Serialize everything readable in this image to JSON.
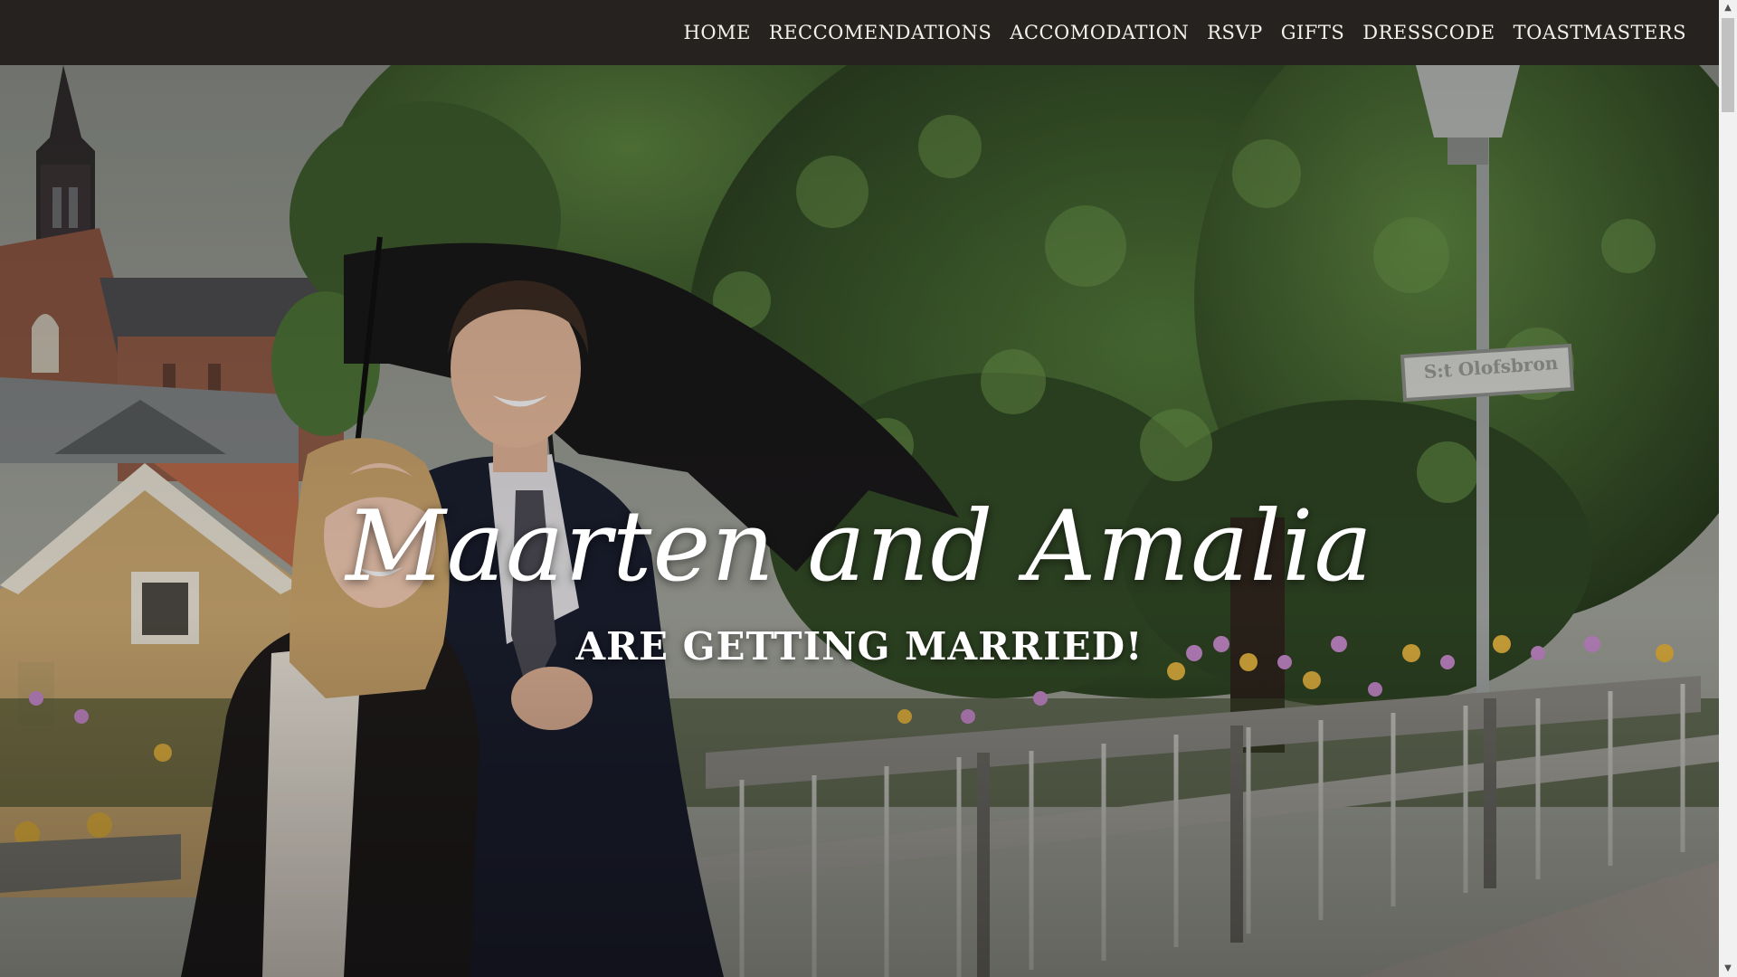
{
  "nav": {
    "items": [
      {
        "label": "HOME"
      },
      {
        "label": "RECCOMENDATIONS"
      },
      {
        "label": "ACCOMODATION"
      },
      {
        "label": "RSVP"
      },
      {
        "label": "GIFTS"
      },
      {
        "label": "DRESSCODE"
      },
      {
        "label": "TOASTMASTERS"
      }
    ]
  },
  "hero": {
    "title": "Maarten and Amalia",
    "subtitle": "ARE GETTING MARRIED!",
    "street_sign": "S:t Olofsbron"
  },
  "colors": {
    "navbar_bg": "#25221f",
    "nav_text": "#f4f0ea",
    "hero_text": "#ffffff"
  },
  "scrollbar": {
    "up_icon": "chevron-up-icon",
    "down_icon": "chevron-down-icon"
  }
}
